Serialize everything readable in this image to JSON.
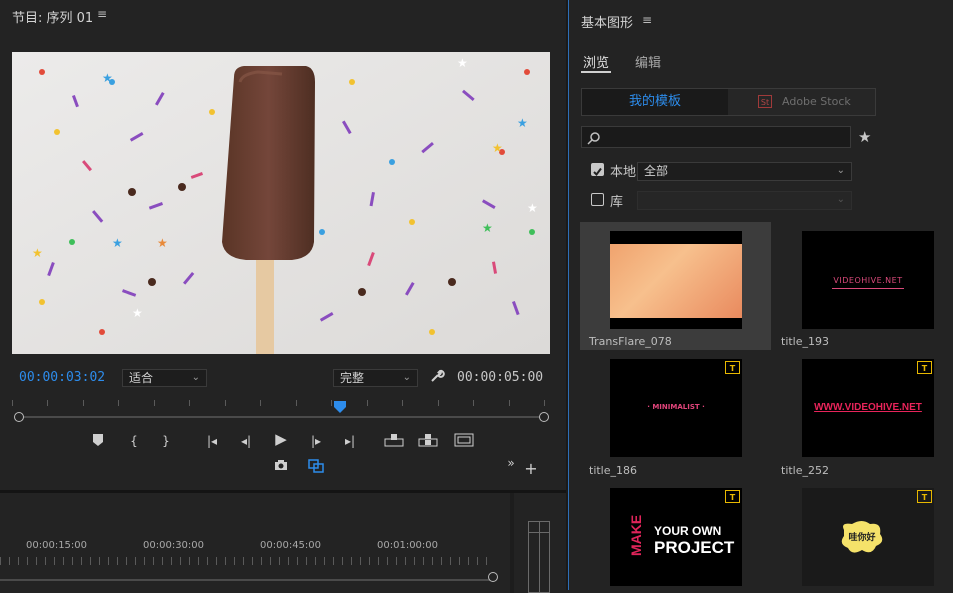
{
  "program_panel": {
    "title": "节目: 序列 01",
    "menu_icon": "menu-icon",
    "current_timecode": "00:00:03:02",
    "fit_select": "适合",
    "quality_select": "完整",
    "duration": "00:00:05:00",
    "wrench_icon": "wrench-icon",
    "transport_icons": [
      "marker-icon",
      "mark-in-icon",
      "mark-out-icon",
      "go-to-in-icon",
      "step-back-icon",
      "play-icon",
      "step-forward-icon",
      "go-to-out-icon",
      "lift-icon",
      "extract-icon",
      "safe-margins-icon"
    ],
    "export_frame_icon": "camera-icon",
    "toggle_proxy_icon": "proxy-icon",
    "overflow_label": "»",
    "add_label": "+"
  },
  "timeline": {
    "ruler_labels": [
      "00:00:15:00",
      "00:00:30:00",
      "00:00:45:00",
      "00:01:00:00"
    ]
  },
  "essential_graphics": {
    "title": "基本图形",
    "menu_icon": "menu-icon",
    "tabs": [
      {
        "label": "浏览",
        "active": true
      },
      {
        "label": "编辑",
        "active": false
      }
    ],
    "source_toggle": {
      "my_templates": "我的模板",
      "stock_badge": "St",
      "adobe_stock": "Adobe Stock"
    },
    "search": {
      "placeholder": "",
      "icon": "search-icon",
      "favorite_icon": "star-icon"
    },
    "local": {
      "checked": true,
      "label": "本地",
      "select": "全部"
    },
    "library": {
      "checked": false,
      "label": "库",
      "select": ""
    },
    "templates": [
      {
        "name": "TransFlare_078",
        "selected": true,
        "badge": false
      },
      {
        "name": "title_193",
        "selected": false,
        "badge": false,
        "preview_text": "VIDEOHIVE.NET"
      },
      {
        "name": "title_186",
        "selected": false,
        "badge": true,
        "preview_text": "· MINIMALIST ·"
      },
      {
        "name": "title_252",
        "selected": false,
        "badge": true,
        "preview_text": "WWW.VIDEOHIVE.NET"
      },
      {
        "name": "",
        "selected": false,
        "badge": true,
        "preview_text": [
          "MAKE",
          "YOUR OWN",
          "PROJECT"
        ]
      },
      {
        "name": "",
        "selected": false,
        "badge": true,
        "preview_text": "哇你好"
      }
    ],
    "badge_text": "T"
  },
  "colors": {
    "accent": "#2d8ceb",
    "panel_bg": "#232323",
    "frame_bg": "#000000"
  }
}
